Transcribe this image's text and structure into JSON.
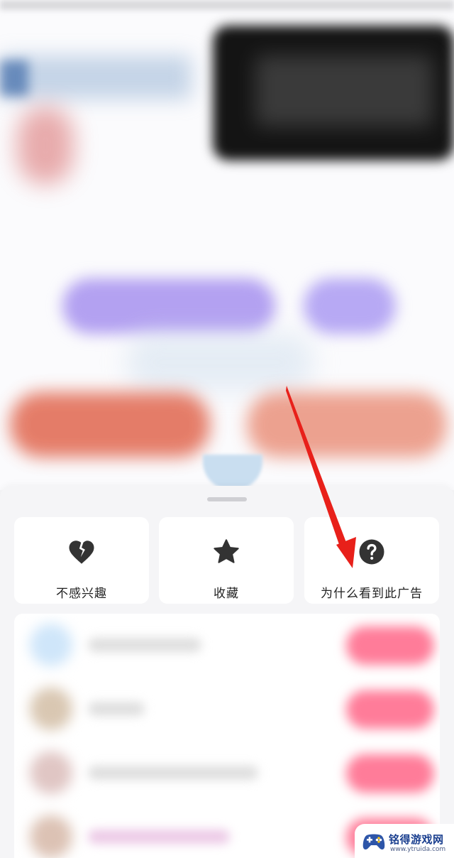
{
  "sheet": {
    "actions": [
      {
        "label": "不感兴趣",
        "icon": "broken-heart-icon"
      },
      {
        "label": "收藏",
        "icon": "star-icon"
      },
      {
        "label": "为什么看到此广告",
        "icon": "question-icon"
      }
    ]
  },
  "watermark": {
    "name": "铭得游戏网",
    "url": "www.ytruida.com"
  },
  "colors": {
    "annotation_arrow": "#e8201a",
    "icon": "#333333",
    "sheet_bg": "#f5f5f7"
  }
}
